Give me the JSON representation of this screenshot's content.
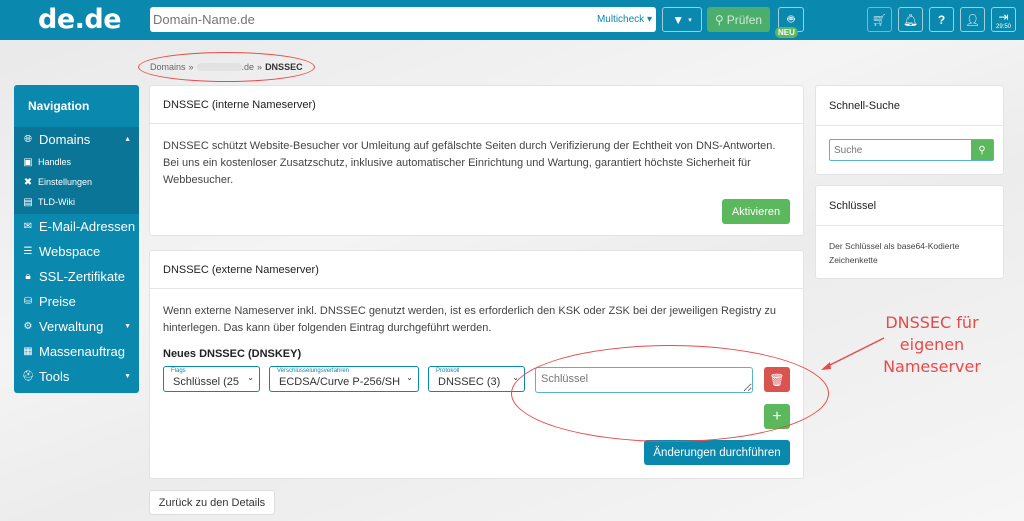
{
  "header": {
    "logo": "de.de",
    "search": {
      "placeholder": "Domain-Name.de",
      "value": ""
    },
    "multicheck_label": "Multicheck",
    "filter_icon": "filter-icon",
    "check_button": "Prüfen",
    "robot_icon": "robot-icon",
    "new_badge": "NEU",
    "icons": [
      "cart-icon",
      "bell-icon",
      "help-icon",
      "user-icon",
      "logout-icon"
    ],
    "session_timer": "29:50"
  },
  "breadcrumb": {
    "items": [
      "Domains",
      ".de",
      "DNSSEC"
    ],
    "separator": "»"
  },
  "sidebar": {
    "title": "Navigation",
    "items": [
      {
        "label": "Domains",
        "icon": "globe-icon",
        "expanded": true,
        "children": [
          {
            "label": "Handles",
            "icon": "id-card-icon"
          },
          {
            "label": "Einstellungen",
            "icon": "tools-icon"
          },
          {
            "label": "TLD-Wiki",
            "icon": "book-icon"
          }
        ]
      },
      {
        "label": "E-Mail-Adressen",
        "icon": "envelope-icon"
      },
      {
        "label": "Webspace",
        "icon": "server-icon"
      },
      {
        "label": "SSL-Zertifikate",
        "icon": "lock-icon"
      },
      {
        "label": "Preise",
        "icon": "coins-icon"
      },
      {
        "label": "Verwaltung",
        "icon": "cogs-icon",
        "has_submenu": true
      },
      {
        "label": "Massenauftrag",
        "icon": "list-icon"
      },
      {
        "label": "Tools",
        "icon": "toolbox-icon",
        "has_submenu": true
      }
    ]
  },
  "internal": {
    "title": "DNSSEC (interne Nameserver)",
    "text": "DNSSEC schützt Website-Besucher vor Umleitung auf gefälschte Seiten durch Verifizierung der Echtheit von DNS-Antworten. Bei uns ein kostenloser Zusatzschutz, inklusive automatischer Einrichtung und Wartung, garantiert höchste Sicherheit für Webbesucher.",
    "activate_button": "Aktivieren"
  },
  "external": {
    "title": "DNSSEC (externe Nameserver)",
    "text": "Wenn externe Nameserver inkl. DNSSEC genutzt werden, ist es erforderlich den KSK oder ZSK bei der jeweiligen Registry zu hinterlegen. Das kann über folgenden Eintrag durchgeführt werden.",
    "subheading": "Neues DNSSEC (DNSKEY)",
    "flags": {
      "label": "Flags",
      "value": "Schlüssel (25"
    },
    "algorithm": {
      "label": "Verschlüsselungsverfahren",
      "value": "ECDSA/Curve P-256/SH"
    },
    "protocol": {
      "label": "Protokoll",
      "value": "DNSSEC (3)"
    },
    "key": {
      "placeholder": "Schlüssel",
      "value": ""
    },
    "submit_button": "Änderungen durchführen"
  },
  "back_button": "Zurück zu den Details",
  "quick_search": {
    "title": "Schnell-Suche",
    "placeholder": "Suche"
  },
  "key_info": {
    "title": "Schlüssel",
    "text": "Der Schlüssel als base64-Kodierte Zeichenkette"
  },
  "annotation": {
    "text_lines": [
      "DNSSEC für",
      "eigenen",
      "Nameserver"
    ],
    "color": "#e84a4a"
  },
  "colors": {
    "brand": "#0b88ad",
    "success": "#5cb85c",
    "danger": "#d9534f"
  }
}
